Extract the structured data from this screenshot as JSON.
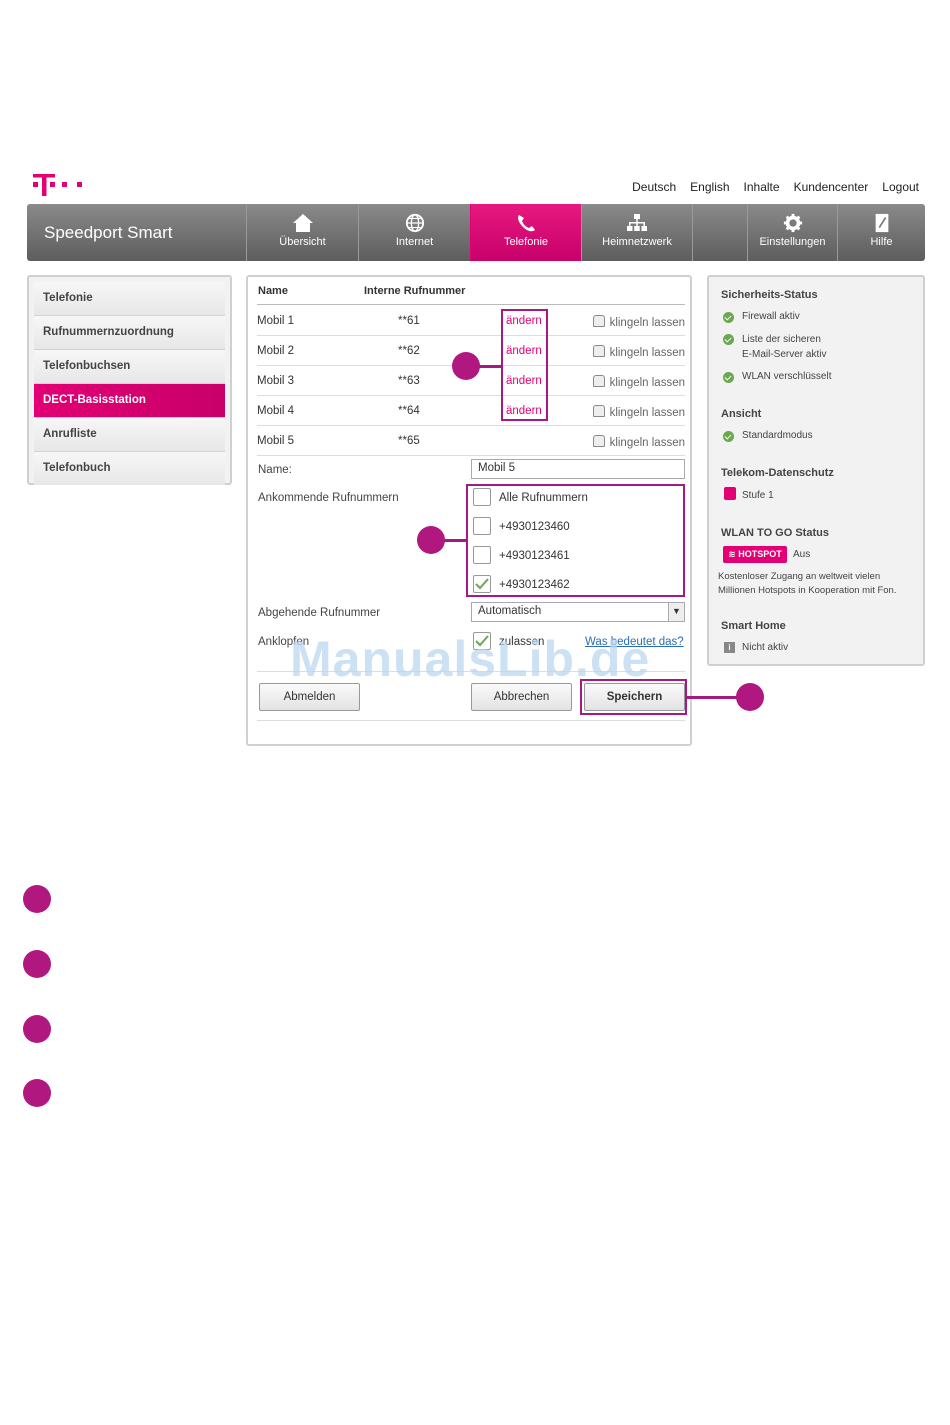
{
  "colors": {
    "accent": "#e20074",
    "annotation": "#a51a80",
    "watermark": "#bcd7f0"
  },
  "top_links": [
    "Deutsch",
    "English",
    "Inhalte",
    "Kundencenter",
    "Logout"
  ],
  "navbar": {
    "brand": "Speedport Smart",
    "items": [
      {
        "label": "Übersicht",
        "icon": "home-icon"
      },
      {
        "label": "Internet",
        "icon": "globe-icon"
      },
      {
        "label": "Telefonie",
        "icon": "phone-icon"
      },
      {
        "label": "Heimnetzwerk",
        "icon": "network-icon"
      },
      {
        "label": "Einstellungen",
        "icon": "gear-icon"
      },
      {
        "label": "Hilfe",
        "icon": "help-book-icon"
      }
    ],
    "active": "Telefonie"
  },
  "sidebar": {
    "items": [
      "Telefonie",
      "Rufnummernzuordnung",
      "Telefonbuchsen",
      "DECT-Basisstation",
      "Anrufliste",
      "Telefonbuch"
    ],
    "active": "DECT-Basisstation"
  },
  "main": {
    "columns": [
      "Name",
      "Interne Rufnummer"
    ],
    "rows": [
      {
        "name": "Mobil 1",
        "number": "**61",
        "action": "ändern",
        "ring": "klingeln lassen"
      },
      {
        "name": "Mobil 2",
        "number": "**62",
        "action": "ändern",
        "ring": "klingeln lassen"
      },
      {
        "name": "Mobil 3",
        "number": "**63",
        "action": "ändern",
        "ring": "klingeln lassen"
      },
      {
        "name": "Mobil 4",
        "number": "**64",
        "action": "ändern",
        "ring": "klingeln lassen"
      },
      {
        "name": "Mobil 5",
        "number": "**65",
        "action": "",
        "ring": "klingeln lassen"
      }
    ],
    "name_label": "Name:",
    "name_value": "Mobil 5",
    "incoming_label": "Ankommende Rufnummern",
    "incoming": [
      {
        "label": "Alle Rufnummern",
        "checked": false
      },
      {
        "label": "+4930123460",
        "checked": false
      },
      {
        "label": "+4930123461",
        "checked": false
      },
      {
        "label": "+4930123462",
        "checked": true
      }
    ],
    "outgoing_label": "Abgehende Rufnummer",
    "outgoing_value": "Automatisch",
    "call_waiting_label": "Anklopfen",
    "call_waiting_option": "zulassen",
    "help_link": "Was bedeutet das?",
    "buttons": {
      "logout": "Abmelden",
      "cancel": "Abbrechen",
      "save": "Speichern"
    }
  },
  "status": {
    "security_title": "Sicherheits-Status",
    "security_items": [
      "Firewall aktiv",
      "Liste der sicheren",
      "E-Mail-Server aktiv",
      "WLAN verschlüsselt"
    ],
    "view_title": "Ansicht",
    "view_item": "Standardmodus",
    "privacy_title": "Telekom-Datenschutz",
    "privacy_item": "Stufe 1",
    "wlan_togo_title": "WLAN TO GO Status",
    "hotspot_badge": "HOTSPOT",
    "hotspot_state": "Aus",
    "hotspot_desc_1": "Kostenloser Zugang an weltweit vielen",
    "hotspot_desc_2": "Millionen Hotspots in Kooperation mit Fon.",
    "smarthome_title": "Smart Home",
    "smarthome_item": "Nicht aktiv"
  },
  "watermark": "ManualsLib.de"
}
